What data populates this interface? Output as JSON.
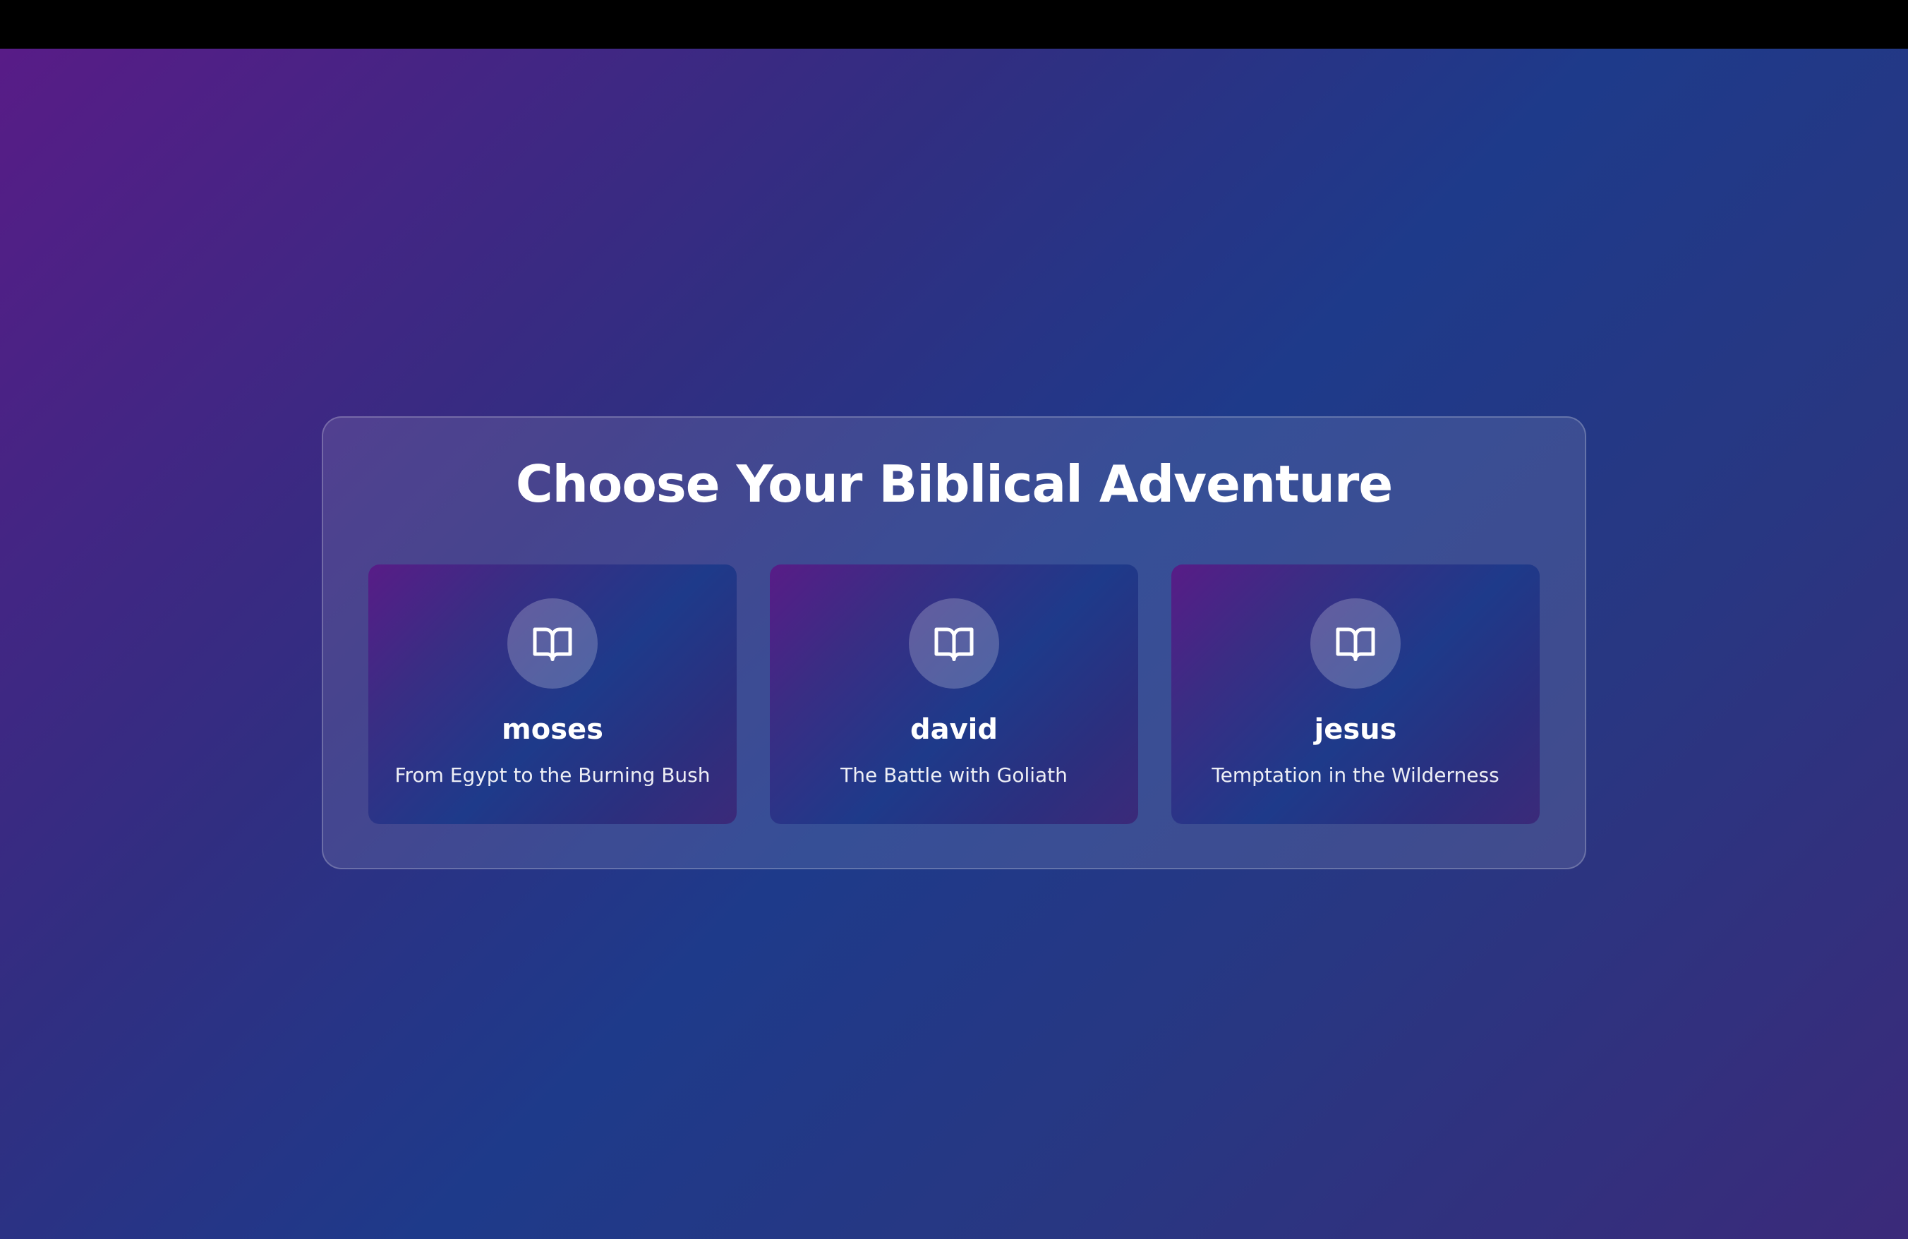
{
  "page": {
    "title": "Choose Your Biblical Adventure"
  },
  "stories": [
    {
      "name": "moses",
      "description": "From Egypt to the Burning Bush",
      "icon": "book-open-icon"
    },
    {
      "name": "david",
      "description": "The Battle with Goliath",
      "icon": "book-open-icon"
    },
    {
      "name": "jesus",
      "description": "Temptation in the Wilderness",
      "icon": "book-open-icon"
    }
  ],
  "colors": {
    "background_start": "#581c87",
    "background_mid": "#1e3a8a",
    "text": "#ffffff"
  }
}
